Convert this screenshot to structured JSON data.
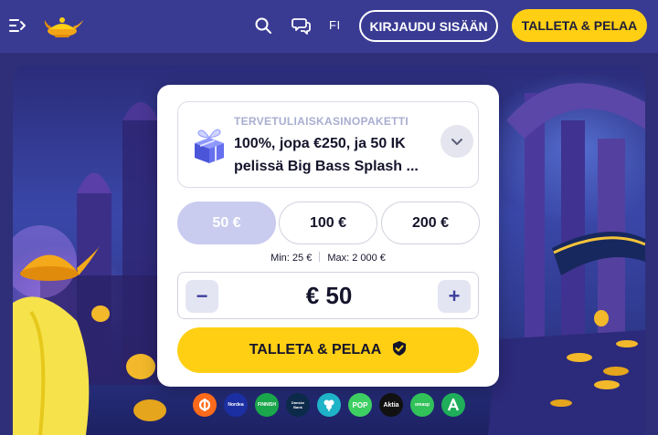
{
  "header": {
    "menu_icon": "menu-collapse-icon",
    "logo_icon": "genie-lamp-logo",
    "search_icon": "search-icon",
    "chat_icon": "chat-bubbles-icon",
    "language": "FI",
    "login_label": "KIRJAUDU SISÄÄN",
    "deposit_label": "TALLETA & PELAA"
  },
  "colors": {
    "header_bg": "#393b93",
    "accent_yellow": "#ffcf14",
    "selected_amount_bg": "#c9cbef",
    "stepper_button_bg": "#e4e5f3"
  },
  "promo": {
    "icon": "gift-box-icon",
    "eyebrow": "TERVETULIAISKASINOPAKETTI",
    "title": "100%, jopa €250, ja 50 IK pelissä Big Bass Splash ...",
    "toggle_icon": "chevron-down-icon"
  },
  "amounts": [
    {
      "label": "50 €",
      "selected": true
    },
    {
      "label": "100 €",
      "selected": false
    },
    {
      "label": "200 €",
      "selected": false
    }
  ],
  "limits": {
    "min": "Min: 25 €",
    "max": "Max: 2 000 €"
  },
  "stepper": {
    "minus": "−",
    "plus": "+",
    "value": "€ 50"
  },
  "deposit_button": {
    "label": "TALLETA & PELAA",
    "icon": "shield-check-icon"
  },
  "payment_methods": [
    {
      "label": "",
      "icon": "p-logo-icon",
      "color": "#ff6b1a"
    },
    {
      "label": "Nordea",
      "color": "#1b2fa3"
    },
    {
      "label": "FINNISH",
      "color": "#1aa64a"
    },
    {
      "label": "Danske Bank",
      "color": "#0c2a4a"
    },
    {
      "label": "",
      "icon": "op-clover-icon",
      "color": "#1fb3c8"
    },
    {
      "label": "POP",
      "color": "#3ecf63"
    },
    {
      "label": "Aktia",
      "color": "#111111"
    },
    {
      "label": "omasp",
      "color": "#31c25a"
    },
    {
      "label": "",
      "icon": "a-logo-icon",
      "color": "#1fae5a"
    }
  ]
}
